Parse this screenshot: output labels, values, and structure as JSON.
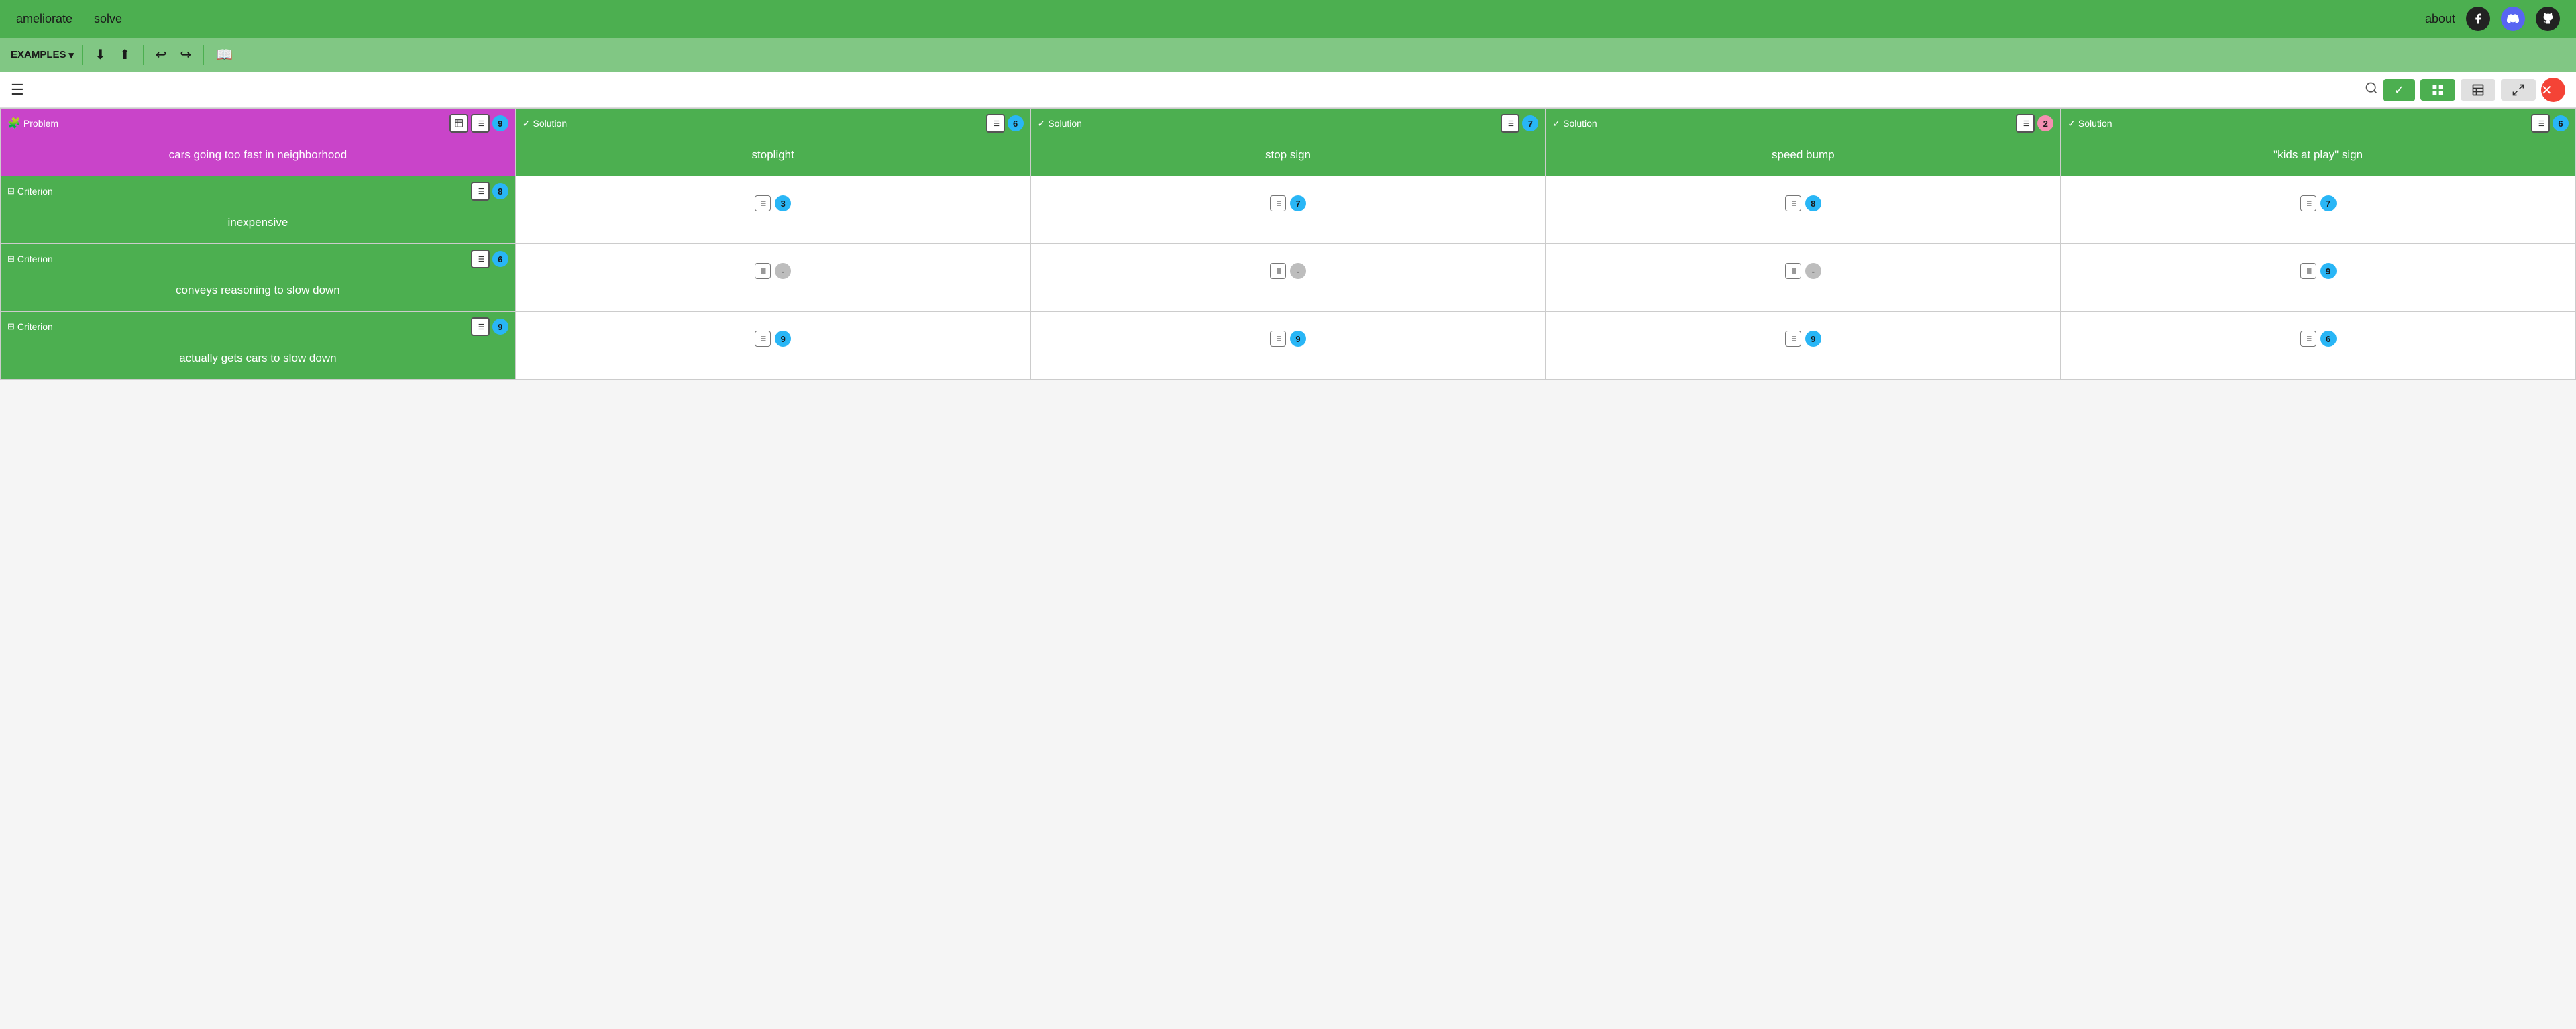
{
  "nav": {
    "brand1": "ameliorate",
    "brand2": "solve",
    "about": "about",
    "social": [
      "facebook",
      "discord",
      "github"
    ]
  },
  "toolbar": {
    "examples_label": "EXAMPLES",
    "download_icon": "⬇",
    "upload_icon": "⬆",
    "undo_icon": "↩",
    "redo_icon": "↪",
    "book_icon": "📖"
  },
  "main_toolbar": {
    "hamburger": "☰",
    "search_icon": "🔍",
    "check_icon": "✓",
    "grid_icon": "⊞",
    "split_icon": "⧉",
    "expand_icon": "⤢",
    "close_icon": "✕"
  },
  "problem": {
    "label": "Problem",
    "title": "cars going too fast in neighborhood",
    "badge": "9",
    "badge_color": "blue"
  },
  "solutions": [
    {
      "label": "Solution",
      "title": "stoplight",
      "badge": "6",
      "badge_color": "blue"
    },
    {
      "label": "Solution",
      "title": "stop sign",
      "badge": "7",
      "badge_color": "blue"
    },
    {
      "label": "Solution",
      "title": "speed bump",
      "badge": "2",
      "badge_color": "pink"
    },
    {
      "label": "Solution",
      "title": "\"kids at play\" sign",
      "badge": "6",
      "badge_color": "blue"
    }
  ],
  "criteria": [
    {
      "label": "Criterion",
      "title": "inexpensive",
      "badge": "8",
      "badge_color": "blue",
      "scores": [
        {
          "value": "3",
          "color": "blue"
        },
        {
          "value": "7",
          "color": "blue"
        },
        {
          "value": "8",
          "color": "blue"
        },
        {
          "value": "7",
          "color": "blue"
        }
      ]
    },
    {
      "label": "Criterion",
      "title": "conveys reasoning to slow down",
      "badge": "6",
      "badge_color": "blue",
      "scores": [
        {
          "value": "-",
          "color": "gray"
        },
        {
          "value": "-",
          "color": "gray"
        },
        {
          "value": "-",
          "color": "gray"
        },
        {
          "value": "9",
          "color": "blue"
        }
      ]
    },
    {
      "label": "Criterion",
      "title": "actually gets cars to slow down",
      "badge": "9",
      "badge_color": "blue",
      "scores": [
        {
          "value": "9",
          "color": "blue"
        },
        {
          "value": "9",
          "color": "blue"
        },
        {
          "value": "9",
          "color": "blue"
        },
        {
          "value": "6",
          "color": "blue"
        }
      ]
    }
  ]
}
